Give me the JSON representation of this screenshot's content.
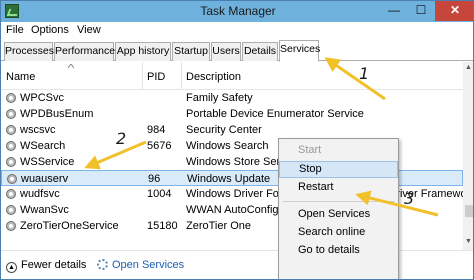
{
  "window": {
    "title": "Task Manager",
    "controls": {
      "minimize": "—",
      "maximize": "☐",
      "close": "✕"
    }
  },
  "menu": [
    "File",
    "Options",
    "View"
  ],
  "tabs": [
    "Processes",
    "Performance",
    "App history",
    "Startup",
    "Users",
    "Details",
    "Services"
  ],
  "active_tab": "Services",
  "columns": {
    "name": "Name",
    "pid": "PID",
    "description": "Description"
  },
  "rows": [
    {
      "name": "WPCSvc",
      "pid": "",
      "description": "Family Safety"
    },
    {
      "name": "WPDBusEnum",
      "pid": "",
      "description": "Portable Device Enumerator Service"
    },
    {
      "name": "wscsvc",
      "pid": "984",
      "description": "Security Center"
    },
    {
      "name": "WSearch",
      "pid": "5676",
      "description": "Windows Search"
    },
    {
      "name": "WSService",
      "pid": "",
      "description": "Windows Store Service (WSService)"
    },
    {
      "name": "wuauserv",
      "pid": "96",
      "description": "Windows Update"
    },
    {
      "name": "wudfsvc",
      "pid": "1004",
      "description": "Windows Driver Foundation - User-mode Driver Framework"
    },
    {
      "name": "WwanSvc",
      "pid": "",
      "description": "WWAN AutoConfig"
    },
    {
      "name": "ZeroTierOneService",
      "pid": "15180",
      "description": "ZeroTier One"
    }
  ],
  "selected_row": "wuauserv",
  "footer": {
    "fewer_details": "Fewer details",
    "open_services": "Open Services"
  },
  "context_menu": {
    "items": [
      {
        "label": "Start",
        "enabled": false
      },
      {
        "label": "Stop",
        "enabled": true,
        "highlighted": true
      },
      {
        "label": "Restart",
        "enabled": true
      },
      {
        "label": "Open Services",
        "enabled": true
      },
      {
        "label": "Search online",
        "enabled": true
      },
      {
        "label": "Go to details",
        "enabled": true
      }
    ]
  },
  "annotations": {
    "marker_1": "1",
    "marker_2": "2",
    "marker_3": "3",
    "arrow_color": "#f2c028"
  },
  "colors": {
    "titlebar": "#6fb1dd",
    "close_button": "#c7463c",
    "selection": "#d9ebf9",
    "link": "#1a5fb4"
  }
}
